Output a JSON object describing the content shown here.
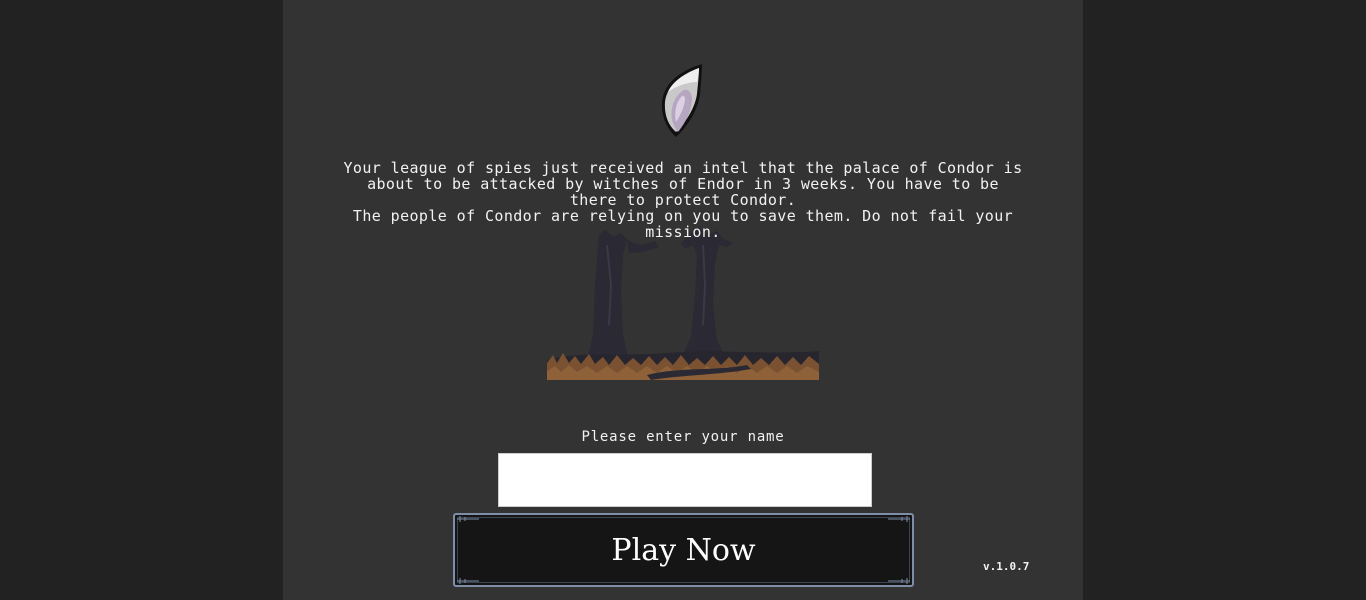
{
  "intro": {
    "line1": "Your league of spies just received an intel that the palace of Condor is about to be attacked by witches of Endor in 3 weeks. You have to be there to protect Condor.",
    "line2": "The people of Condor are relying on you to save them. Do not fail your mission."
  },
  "form": {
    "name_label": "Please enter your name",
    "name_value": "",
    "play_label": "Play Now"
  },
  "version": "v.1.0.7",
  "icons": {
    "logo": "shield-leaf-icon",
    "scene": "forest-trees-illustration"
  },
  "colors": {
    "page_bg": "#222222",
    "panel_bg": "#333333",
    "text": "#f2f2f2",
    "button_bg": "#151515",
    "button_border": "#7d8ea6"
  }
}
